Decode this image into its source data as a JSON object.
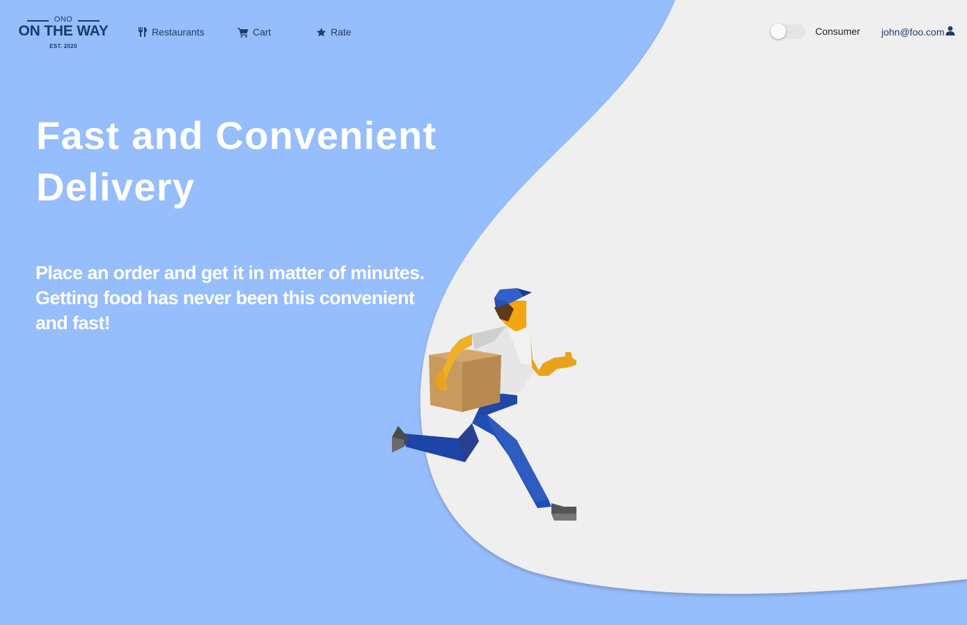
{
  "brand": {
    "top": "ONO",
    "name": "ON THE WAY",
    "est": "EST. 2020"
  },
  "nav": {
    "items": [
      {
        "label": "Restaurants",
        "icon": "utensils-icon"
      },
      {
        "label": "Cart",
        "icon": "cart-icon"
      },
      {
        "label": "Rate",
        "icon": "star-icon"
      }
    ]
  },
  "header": {
    "mode_label": "Consumer",
    "mode_toggle_on": false,
    "account_email": "john@foo.com",
    "account_icon": "user-icon"
  },
  "hero": {
    "title": "Fast and Convenient Delivery",
    "subtitle": "Place an order and get it in matter of minutes. Getting food has never been this convenient and fast!",
    "illustration_icon": "delivery-courier-illustration"
  },
  "colors": {
    "background": "#96bdfc",
    "blob": "#efeff0",
    "nav_text": "#1f3c6a",
    "hero_text": "#ffffff"
  }
}
